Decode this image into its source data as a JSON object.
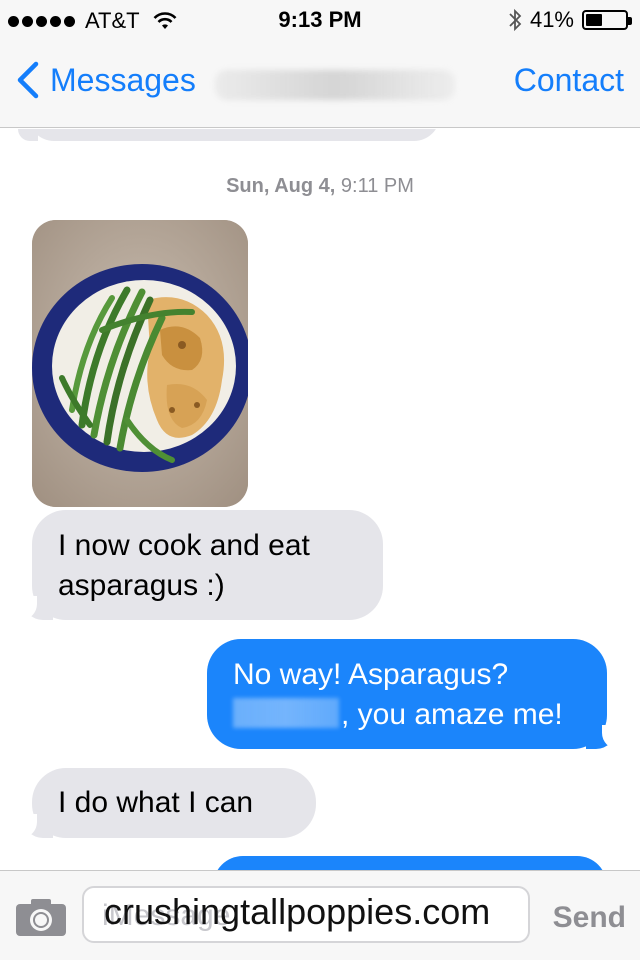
{
  "status_bar": {
    "carrier": "AT&T",
    "time": "9:13 PM",
    "battery": "41%",
    "battery_level": 0.41,
    "icons": [
      "signal-dots-icon",
      "wifi-icon",
      "bluetooth-icon",
      "battery-icon"
    ]
  },
  "nav": {
    "back_label": "Messages",
    "contact_label": "Contact"
  },
  "conversation": {
    "timestamp_day": "Sun, Aug 4,",
    "timestamp_time": "9:11 PM",
    "messages": [
      {
        "type": "photo",
        "direction": "received",
        "description_icon": "food-photo"
      },
      {
        "type": "text",
        "direction": "received",
        "line1": "I now cook and eat",
        "line2": "asparagus :)"
      },
      {
        "type": "text",
        "direction": "sent",
        "line1": "No way!  Asparagus?",
        "line2": ", you amaze me!"
      },
      {
        "type": "text",
        "direction": "received",
        "line1": "I do what I can"
      }
    ]
  },
  "input_bar": {
    "placeholder": "iMessage",
    "watermark": "crushingtallpoppies.com",
    "send_label": "Send"
  },
  "colors": {
    "accent": "#147efb",
    "sent_bubble": "#1b85fb",
    "received_bubble": "#e5e5ea",
    "bar_bg": "#f7f7f7"
  }
}
